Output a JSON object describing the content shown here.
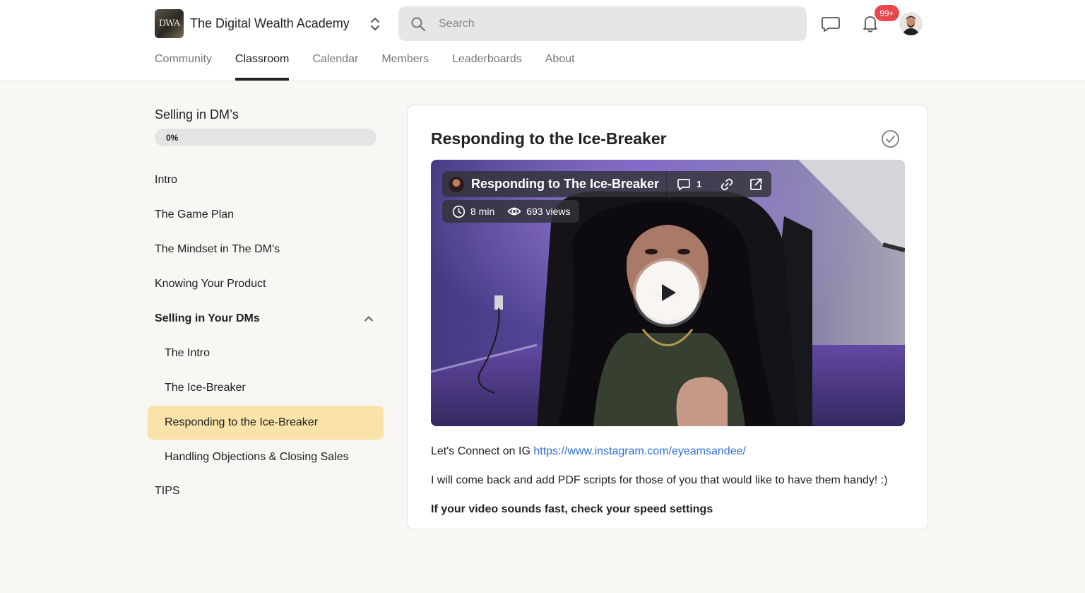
{
  "header": {
    "brand_name": "The Digital Wealth Academy",
    "logo_text": "DWA",
    "search_placeholder": "Search",
    "notification_badge": "99+"
  },
  "nav": {
    "tabs": [
      {
        "label": "Community",
        "active": false
      },
      {
        "label": "Classroom",
        "active": true
      },
      {
        "label": "Calendar",
        "active": false
      },
      {
        "label": "Members",
        "active": false
      },
      {
        "label": "Leaderboards",
        "active": false
      },
      {
        "label": "About",
        "active": false
      }
    ]
  },
  "sidebar": {
    "course_title": "Selling in DM’s",
    "progress_label": "0%",
    "progress_fraction": 0,
    "lessons": [
      {
        "label": "Intro"
      },
      {
        "label": "The Game Plan"
      },
      {
        "label": "The Mindset in The DM's"
      },
      {
        "label": "Knowing Your Product"
      },
      {
        "label": "Selling in Your DMs",
        "section": true,
        "expanded": true
      },
      {
        "label": "The Intro",
        "sub": true
      },
      {
        "label": "The Ice-Breaker",
        "sub": true
      },
      {
        "label": "Responding to the Ice-Breaker",
        "sub": true,
        "active": true
      },
      {
        "label": "Handling Objections & Closing Sales",
        "sub": true
      },
      {
        "label": "TIPS"
      }
    ]
  },
  "content": {
    "title": "Responding to the Ice-Breaker",
    "video": {
      "title": "Responding to The Ice-Breaker",
      "comment_count": "1",
      "duration": "8 min",
      "views": "693 views"
    },
    "desc_prefix": "Let's Connect on IG ",
    "desc_link": "https://www.instagram.com/eyeamsandee/",
    "desc_line2": "I will come back and add PDF scripts for those of you that would like to have them handy! :)",
    "desc_line3": "If your video sounds fast, check your speed settings"
  },
  "colors": {
    "active_lesson_bg": "#fae3a8",
    "badge_red": "#e5484d",
    "link_blue": "#2f6fd6",
    "page_bg": "#f8f7f4"
  }
}
